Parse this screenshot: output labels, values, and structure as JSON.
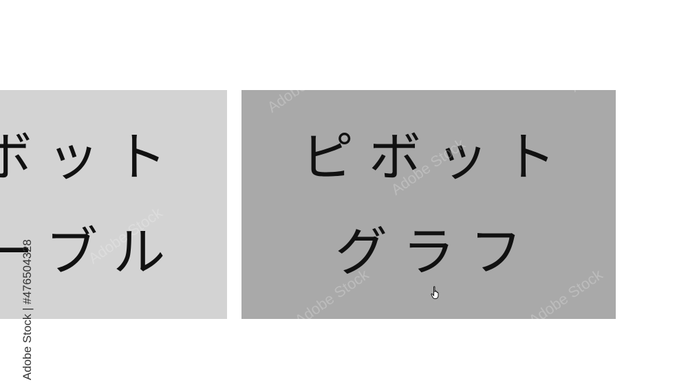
{
  "tiles": [
    {
      "lines": [
        "ピボット",
        "テーブル"
      ]
    },
    {
      "lines": [
        "ピボット",
        "グラフ"
      ]
    }
  ],
  "watermark": {
    "side_text": "Adobe Stock | #476504328",
    "logo_text": "Adobe Stock"
  },
  "cursor": {
    "icon": "hand-pointer-icon"
  }
}
